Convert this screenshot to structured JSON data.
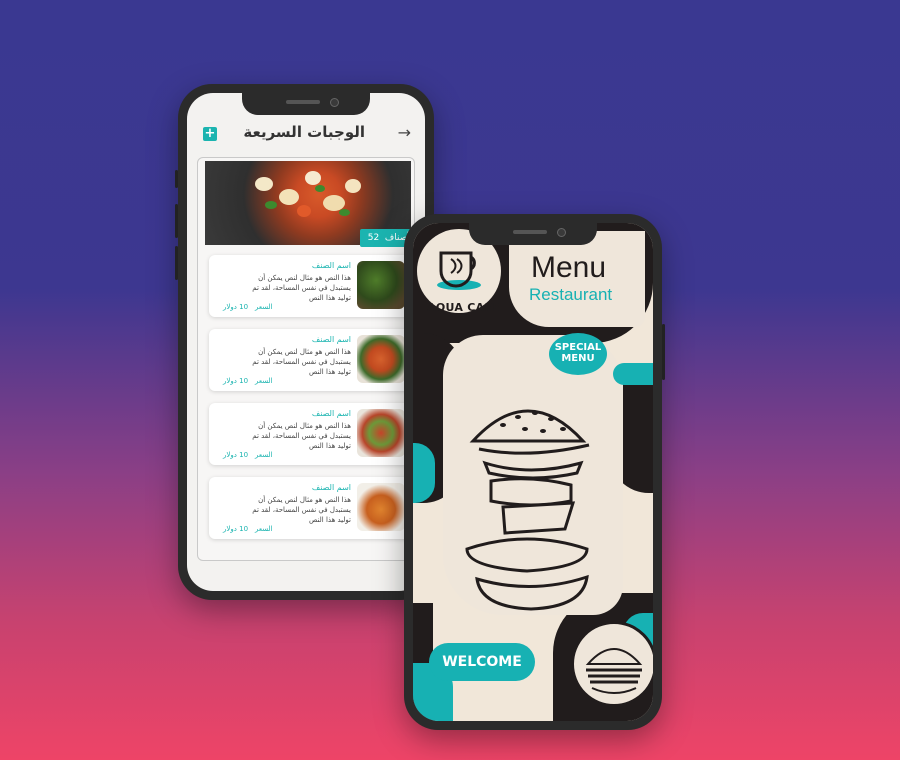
{
  "phone1": {
    "header": {
      "add_icon": "plus-icon",
      "title": "الوجبات السريعة",
      "back_icon": "arrow-right-icon"
    },
    "hero": {
      "count_value": "52",
      "count_label": "الأصناف"
    },
    "items": [
      {
        "name": "اسم الصنف",
        "desc": "هذا النص هو مثال لنص يمكن أن يستبدل في نفس المساحة، لقد تم توليد هذا النص",
        "price_label": "السعر",
        "price": "10 دولار"
      },
      {
        "name": "اسم الصنف",
        "desc": "هذا النص هو مثال لنص يمكن أن يستبدل في نفس المساحة، لقد تم توليد هذا النص",
        "price_label": "السعر",
        "price": "10 دولار"
      },
      {
        "name": "اسم الصنف",
        "desc": "هذا النص هو مثال لنص يمكن أن يستبدل في نفس المساحة، لقد تم توليد هذا النص",
        "price_label": "السعر",
        "price": "10 دولار"
      },
      {
        "name": "اسم الصنف",
        "desc": "هذا النص هو مثال لنص يمكن أن يستبدل في نفس المساحة، لقد تم توليد هذا النص",
        "price_label": "السعر",
        "price": "10 دولار"
      }
    ]
  },
  "phone2": {
    "logo_text": "AQUA CAFE",
    "menu_title": "Menu",
    "menu_subtitle": "Restaurant",
    "special_line1": "SPECIAL",
    "special_line2": "MENU",
    "welcome": "WELCOME"
  },
  "colors": {
    "accent": "#1bb4b0",
    "dark": "#211c1c",
    "cream": "#f1e7d9",
    "bg_top": "#3a3891",
    "bg_bottom": "#ee4467"
  }
}
